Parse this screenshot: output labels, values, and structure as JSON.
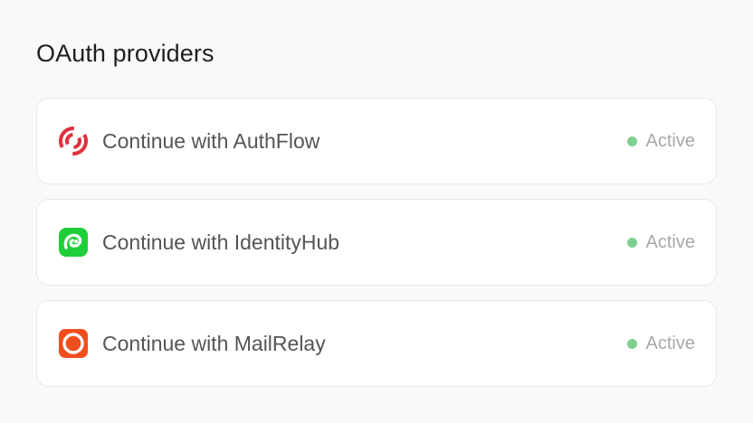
{
  "section": {
    "title": "OAuth providers"
  },
  "providers": [
    {
      "label": "Continue with AuthFlow",
      "status": "Active",
      "icon": "authflow-logo-icon",
      "icon_color": "#e0313d"
    },
    {
      "label": "Continue with IdentityHub",
      "status": "Active",
      "icon": "identityhub-logo-icon",
      "icon_color": "#1fcf3a"
    },
    {
      "label": "Continue with MailRelay",
      "status": "Active",
      "icon": "mailrelay-logo-icon",
      "icon_color": "#f04e1c"
    }
  ],
  "colors": {
    "status_dot": "#7fd08f",
    "status_text": "#a8a8a8",
    "label_text": "#555555",
    "title_text": "#1f1f1f",
    "card_border": "#e8e8e8",
    "background": "#f9f9f9"
  }
}
